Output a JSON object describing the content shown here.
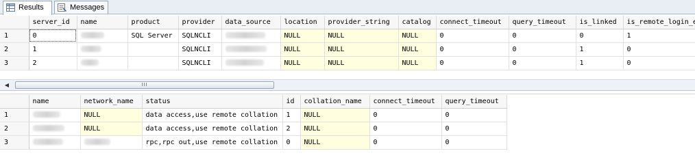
{
  "tabs": [
    {
      "label": "Results",
      "icon": "grid-icon",
      "active": true
    },
    {
      "label": "Messages",
      "icon": "messages-icon",
      "active": false
    }
  ],
  "grid1": {
    "columns": [
      "server_id",
      "name",
      "product",
      "provider",
      "data_source",
      "location",
      "provider_string",
      "catalog",
      "connect_timeout",
      "query_timeout",
      "is_linked",
      "is_remote_login_en"
    ],
    "rows": [
      {
        "num": "1",
        "cells": [
          "0",
          "",
          "SQL Server",
          "SQLNCLI",
          "",
          "NULL",
          "NULL",
          "NULL",
          "0",
          "0",
          "0",
          "1"
        ]
      },
      {
        "num": "2",
        "cells": [
          "1",
          "",
          "",
          "SQLNCLI",
          "",
          "NULL",
          "NULL",
          "NULL",
          "0",
          "0",
          "1",
          "0"
        ]
      },
      {
        "num": "3",
        "cells": [
          "2",
          "",
          "",
          "SQLNCLI",
          "",
          "NULL",
          "NULL",
          "NULL",
          "0",
          "0",
          "1",
          "0"
        ]
      }
    ]
  },
  "scrollbar": {
    "thumb_grip": "III"
  },
  "grid2": {
    "columns": [
      "name",
      "network_name",
      "status",
      "id",
      "collation_name",
      "connect_timeout",
      "query_timeout"
    ],
    "rows": [
      {
        "num": "1",
        "cells": [
          "",
          "NULL",
          "data access,use remote collation",
          "1",
          "NULL",
          "0",
          "0"
        ]
      },
      {
        "num": "2",
        "cells": [
          "",
          "NULL",
          "data access,use remote collation",
          "2",
          "NULL",
          "0",
          "0"
        ]
      },
      {
        "num": "3",
        "cells": [
          "",
          "",
          "rpc,rpc out,use remote collation",
          "0",
          "NULL",
          "0",
          "0"
        ]
      }
    ]
  }
}
